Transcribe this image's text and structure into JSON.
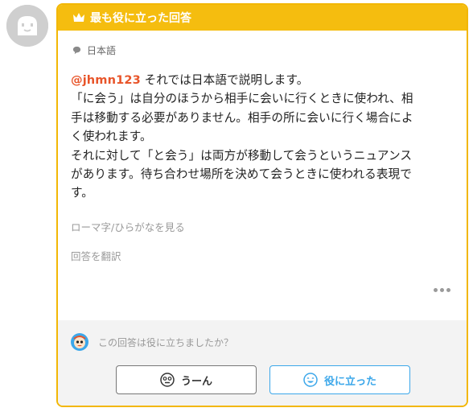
{
  "header": {
    "title": "最も役に立った回答"
  },
  "answer": {
    "language": "日本語",
    "mention": "@jhmn123",
    "lines": [
      " それでは日本語で説明します。",
      "「に会う」は自分のほうから相手に会いに行くときに使われ、相",
      "手は移動する必要がありません。相手の所に会いに行く場合によ",
      "く使われます。",
      "それに対して「と会う」は両方が移動して会うというニュアンス",
      "があります。待ち合わせ場所を決めて会うときに使われる表現で",
      "す。"
    ],
    "romaji_link": "ローマ字/ひらがなを見る",
    "translate_link": "回答を翻訳"
  },
  "footer": {
    "question": "この回答は役に立ちましたか？",
    "meh_label": "うーん",
    "helpful_label": "役に立った"
  },
  "colors": {
    "header": "#f5bd0f",
    "mention": "#e8552a",
    "helpful": "#3ba7ea"
  }
}
